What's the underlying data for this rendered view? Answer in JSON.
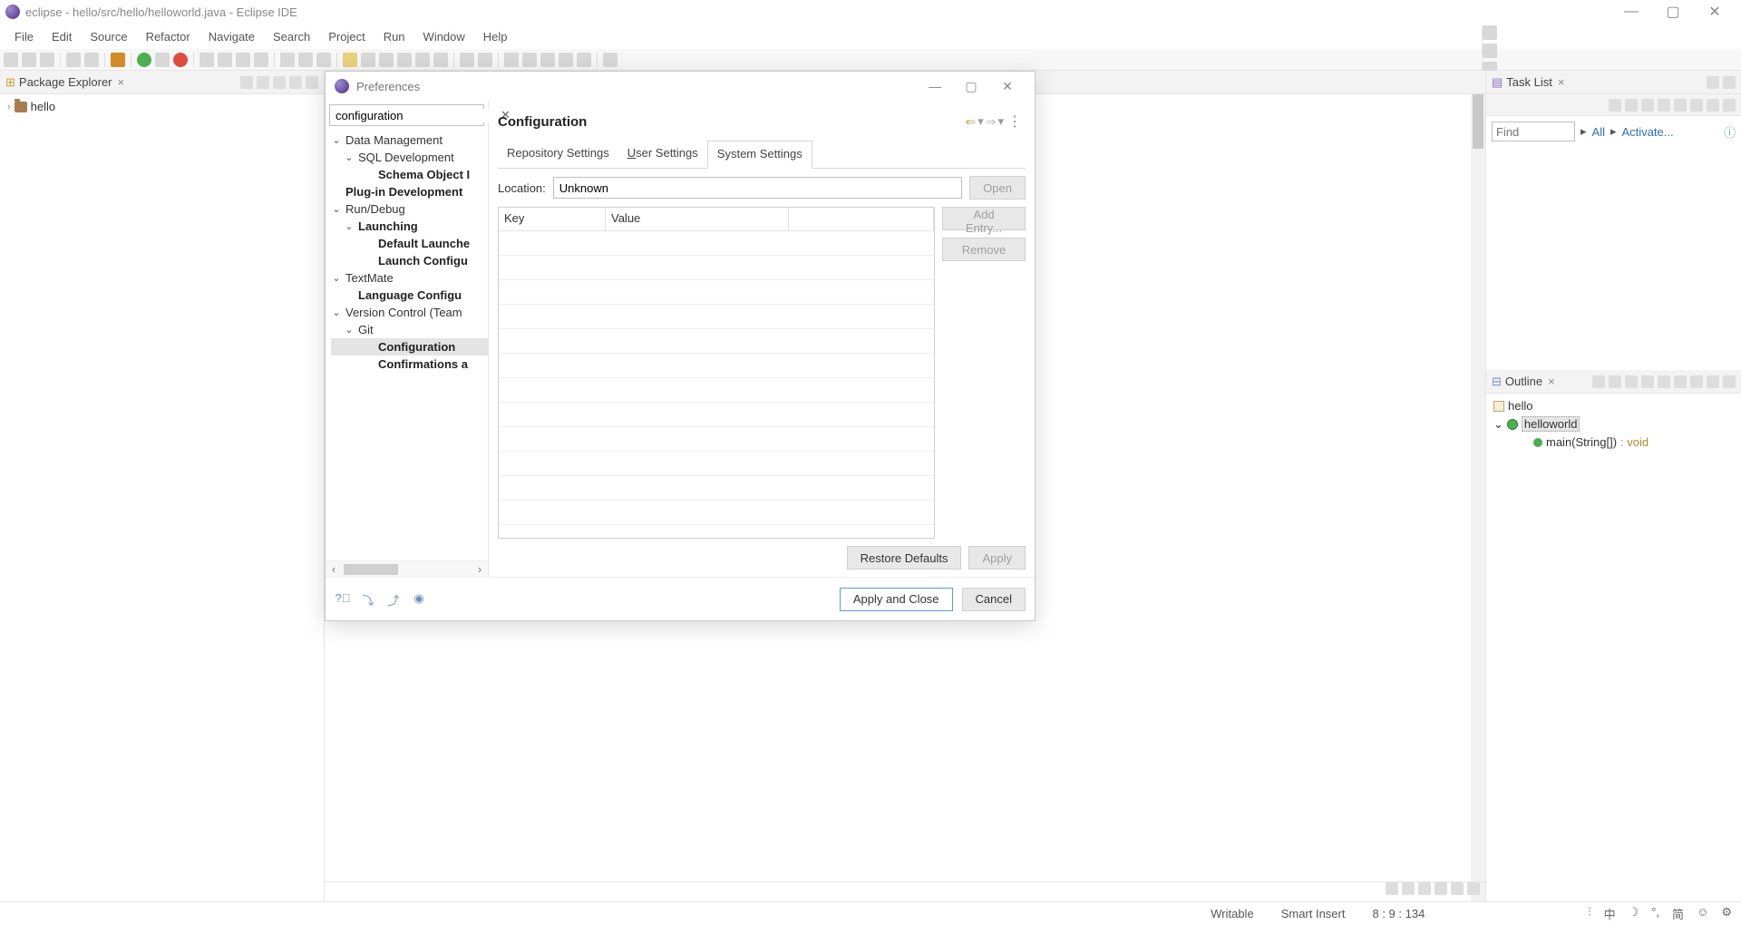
{
  "window": {
    "title": "eclipse - hello/src/hello/helloworld.java - Eclipse IDE"
  },
  "menubar": [
    "File",
    "Edit",
    "Source",
    "Refactor",
    "Navigate",
    "Search",
    "Project",
    "Run",
    "Window",
    "Help"
  ],
  "packageExplorer": {
    "title": "Package Explorer",
    "project": "hello"
  },
  "taskList": {
    "title": "Task List",
    "find_placeholder": "Find",
    "all": "All",
    "activate": "Activate..."
  },
  "outline": {
    "title": "Outline",
    "package": "hello",
    "class": "helloworld",
    "method": "main(String[])",
    "returns": ": void"
  },
  "status": {
    "writable": "Writable",
    "insert": "Smart Insert",
    "pos": "8 : 9 : 134"
  },
  "dialog": {
    "title": "Preferences",
    "filter_value": "configuration",
    "page_title": "Configuration",
    "tree": {
      "n0": "Data Management",
      "n0_0": "SQL Development",
      "n0_0_0": "Schema Object I",
      "n1": "Plug-in Development",
      "n2": "Run/Debug",
      "n2_0": "Launching",
      "n2_0_0": "Default Launche",
      "n2_0_1": "Launch Configu",
      "n3": "TextMate",
      "n3_0": "Language Configu",
      "n4": "Version Control (Team",
      "n4_0": "Git",
      "n4_0_0": "Configuration",
      "n4_0_1": "Confirmations a"
    },
    "tabs": {
      "repo": "Repository Settings",
      "user_pre": "U",
      "user_post": "ser Settings",
      "system": "System Settings"
    },
    "location_label": "Location:",
    "location_value": "Unknown",
    "open": "Open",
    "col_key": "Key",
    "col_value": "Value",
    "add_entry_pre": "Add ",
    "add_entry_u": "E",
    "add_entry_post": "ntry...",
    "remove_pre": "",
    "remove_u": "R",
    "remove_post": "emove",
    "restore_pre": "Restore ",
    "restore_u": "D",
    "restore_post": "efaults",
    "apply_pre": "",
    "apply_u": "A",
    "apply_post": "pply",
    "apply_close": "Apply and Close",
    "cancel": "Cancel"
  }
}
